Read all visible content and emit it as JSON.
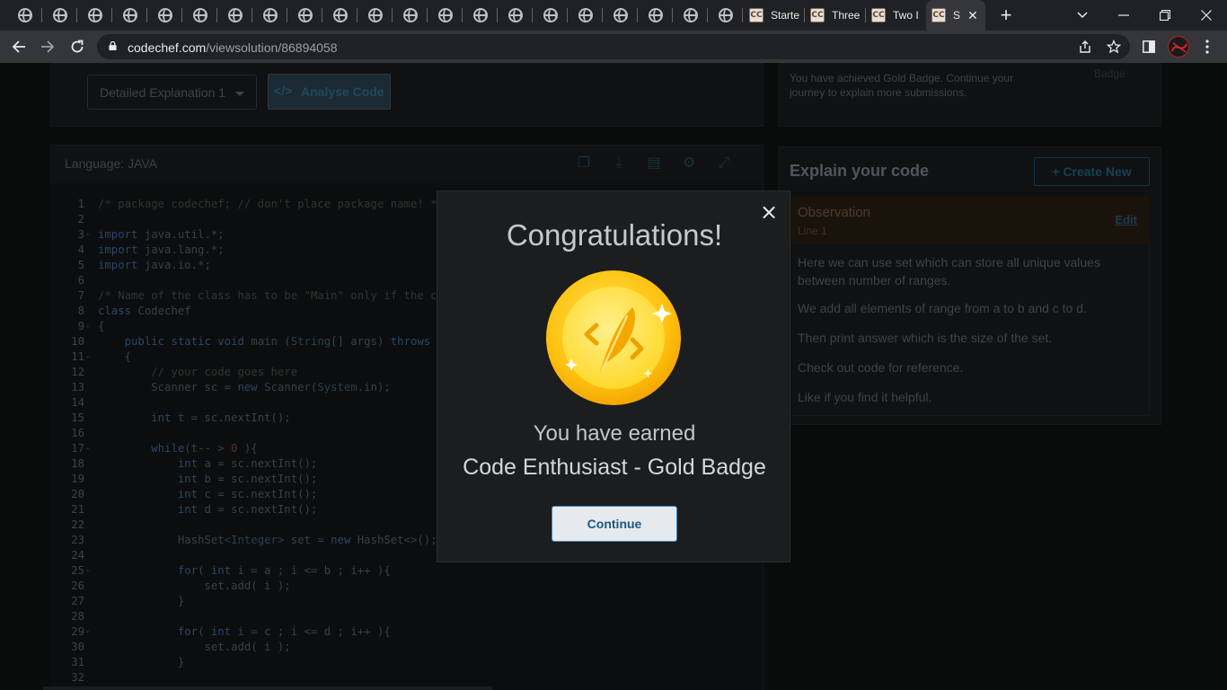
{
  "browser": {
    "tabs": [
      {
        "title": "Starte"
      },
      {
        "title": "Three"
      },
      {
        "title": "Two I"
      },
      {
        "title": "S",
        "active": true
      }
    ],
    "favicon_label": "CC",
    "url_domain": "codechef.com",
    "url_path": "/viewsolution/86894058"
  },
  "left": {
    "dropdown": "Detailed Explanation 1",
    "analyse_label": "Analyse Code",
    "language": "Language: JAVA",
    "code_lines": [
      "1",
      "2",
      "3",
      "4",
      "5",
      "6",
      "7",
      "8",
      "9",
      "10",
      "11",
      "12",
      "13",
      "14",
      "15",
      "16",
      "17",
      "18",
      "19",
      "20",
      "21",
      "22",
      "23",
      "24",
      "25",
      "26",
      "27",
      "28",
      "29",
      "30",
      "31",
      "32"
    ]
  },
  "right": {
    "gold_note": "You have achieved Gold Badge. Continue your journey to explain more submissions.",
    "gold_note_line1": "You have achieved Gold Badge. Continue your",
    "gold_note_line2": "journey to explain more submissions.",
    "badge_corner": "Badge",
    "explain_title": "Explain your code",
    "create_new": "+ Create New",
    "observation_title": "Observation",
    "observation_line": "Line 1",
    "edit_link": "Edit",
    "paragraphs": [
      "Here we can use set which can store all unique values",
      "between number of ranges.",
      "We add all elements of range from a to b and c to d.",
      "Then print answer which is the size of the set.",
      "Check out code for reference.",
      "Like if you find it helpful."
    ]
  },
  "modal": {
    "title": "Congratulations!",
    "earned_text": "You have earned",
    "badge_name": "Code Enthusiast - Gold Badge",
    "continue_label": "Continue",
    "close_glyph": "×"
  },
  "colors": {
    "accent": "#3a87c8",
    "gold": "#ffc21a"
  }
}
